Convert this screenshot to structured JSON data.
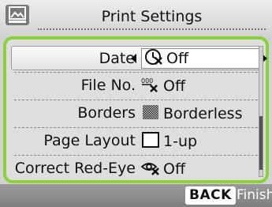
{
  "header": {
    "title": "Print Settings",
    "icon": "print-settings-icon"
  },
  "settings": [
    {
      "label": "Date",
      "value": "Off",
      "icon": "date-off-icon",
      "selected": true
    },
    {
      "label": "File No.",
      "value": "Off",
      "icon": "file-number-off-icon",
      "selected": false
    },
    {
      "label": "Borders",
      "value": "Borderless",
      "icon": "borderless-icon",
      "selected": false
    },
    {
      "label": "Page Layout",
      "value": "1-up",
      "icon": "page-layout-1up-icon",
      "selected": false
    },
    {
      "label": "Correct Red-Eye",
      "value": "Off",
      "icon": "red-eye-off-icon",
      "selected": false
    }
  ],
  "footer": {
    "back_label": "BACK",
    "finish_label": "Finish"
  },
  "colors": {
    "accent": "#8ad13a",
    "footer": "#8a8a8a",
    "panel": "#dedede"
  }
}
